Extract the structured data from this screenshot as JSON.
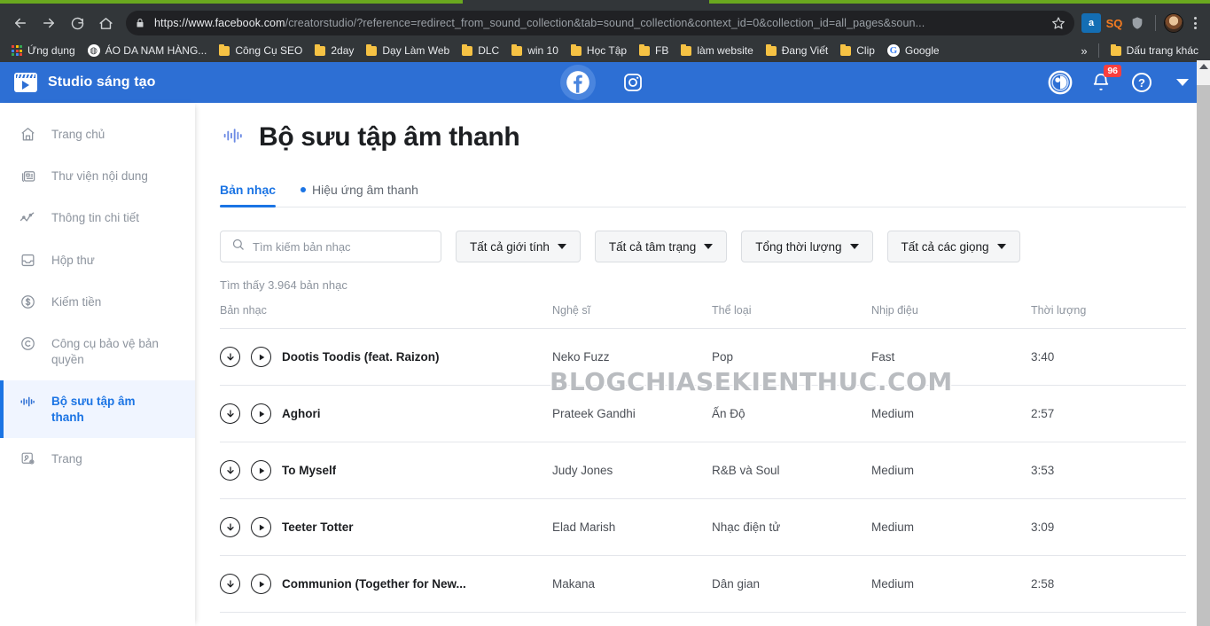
{
  "browser": {
    "url_prefix": "https://",
    "url_domain": "www.facebook.com",
    "url_path": "/creatorstudio/?reference=redirect_from_sound_collection&tab=sound_collection&context_id=0&collection_id=all_pages&soun...",
    "nav": {
      "back": "back-arrow",
      "forward": "forward-arrow",
      "reload": "reload",
      "home": "home"
    },
    "extensions": [
      {
        "name": "amazon-assistant",
        "label": "a"
      },
      {
        "name": "seoquake",
        "label": "SQ"
      },
      {
        "name": "shield-extension",
        "label": ""
      }
    ],
    "bookmarks": [
      {
        "label": "Ứng dụng",
        "icon": "apps-grid"
      },
      {
        "label": "ÁO DA NAM HÀNG...",
        "icon": "globe"
      },
      {
        "label": "Công Cụ SEO",
        "icon": "folder"
      },
      {
        "label": "2day",
        "icon": "folder"
      },
      {
        "label": "Dạy Làm Web",
        "icon": "folder"
      },
      {
        "label": "DLC",
        "icon": "folder"
      },
      {
        "label": "win 10",
        "icon": "folder"
      },
      {
        "label": "Học Tập",
        "icon": "folder"
      },
      {
        "label": "FB",
        "icon": "folder"
      },
      {
        "label": "làm website",
        "icon": "folder"
      },
      {
        "label": "Đang Viết",
        "icon": "folder"
      },
      {
        "label": "Clip",
        "icon": "folder"
      },
      {
        "label": "Google",
        "icon": "google"
      }
    ],
    "bookmarks_overflow": "»",
    "bookmarks_other": {
      "label": "Dấu trang khác",
      "icon": "folder"
    }
  },
  "fb_header": {
    "brand": "Studio sáng tạo",
    "platforms": [
      {
        "name": "facebook",
        "active": true
      },
      {
        "name": "instagram",
        "active": false
      }
    ],
    "notifications_badge": "96",
    "help": "?",
    "accent": "#2d6fd4"
  },
  "sidebar": {
    "items": [
      {
        "label": "Trang chủ",
        "icon": "home-icon",
        "active": false
      },
      {
        "label": "Thư viện nội dung",
        "icon": "library-icon",
        "active": false
      },
      {
        "label": "Thông tin chi tiết",
        "icon": "insights-icon",
        "active": false
      },
      {
        "label": "Hộp thư",
        "icon": "inbox-icon",
        "active": false
      },
      {
        "label": "Kiếm tiền",
        "icon": "monetization-icon",
        "active": false
      },
      {
        "label": "Công cụ bảo vệ bản quyền",
        "icon": "copyright-icon",
        "active": false
      },
      {
        "label": "Bộ sưu tập âm thanh",
        "icon": "sound-wave-icon",
        "active": true
      },
      {
        "label": "Trang",
        "icon": "page-settings-icon",
        "active": false
      }
    ],
    "active_color": "#1b74e4"
  },
  "main": {
    "title": "Bộ sưu tập âm thanh",
    "tabs": [
      {
        "label": "Bản nhạc",
        "active": true,
        "dot": false
      },
      {
        "label": "Hiệu ứng âm thanh",
        "active": false,
        "dot": true
      }
    ],
    "search": {
      "placeholder": "Tìm kiếm bản nhạc",
      "value": ""
    },
    "filters": [
      {
        "label": "Tất cả giới tính"
      },
      {
        "label": "Tất cả tâm trạng"
      },
      {
        "label": "Tổng thời lượng"
      },
      {
        "label": "Tất cả các giọng"
      }
    ],
    "result_count_text": "Tìm thấy 3.964 bản nhạc",
    "table": {
      "columns": [
        "Bản nhạc",
        "Nghệ sĩ",
        "Thể loại",
        "Nhịp điệu",
        "Thời lượng"
      ],
      "rows": [
        {
          "track": "Dootis Toodis (feat. Raizon)",
          "artist": "Neko Fuzz",
          "genre": "Pop",
          "tempo": "Fast",
          "duration": "3:40"
        },
        {
          "track": "Aghori",
          "artist": "Prateek Gandhi",
          "genre": "Ấn Độ",
          "tempo": "Medium",
          "duration": "2:57"
        },
        {
          "track": "To Myself",
          "artist": "Judy Jones",
          "genre": "R&B và Soul",
          "tempo": "Medium",
          "duration": "3:53"
        },
        {
          "track": "Teeter Totter",
          "artist": "Elad Marish",
          "genre": "Nhạc điện tử",
          "tempo": "Medium",
          "duration": "3:09"
        },
        {
          "track": "Communion (Together for New...",
          "artist": "Makana",
          "genre": "Dân gian",
          "tempo": "Medium",
          "duration": "2:58"
        }
      ]
    },
    "watermark": "BLOGCHIASEKIENTHUC.COM"
  }
}
